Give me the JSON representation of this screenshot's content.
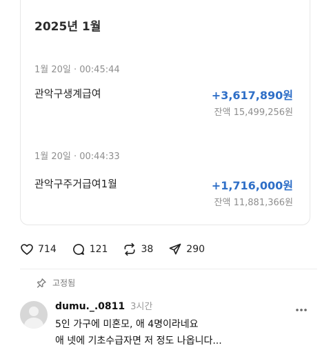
{
  "card": {
    "month_title": "2025년 1월",
    "transactions": [
      {
        "date": "1월 20일 · 00:45:44",
        "name": "관악구생계급여",
        "amount": "+3,617,890원",
        "balance": "잔액 15,499,256원"
      },
      {
        "date": "1월 20일 · 00:44:33",
        "name": "관악구주거급여1월",
        "amount": "+1,716,000원",
        "balance": "잔액 11,881,366원"
      }
    ]
  },
  "actions": {
    "like_count": "714",
    "reply_count": "121",
    "repost_count": "38",
    "share_count": "290"
  },
  "pinned": {
    "label": "고정됨"
  },
  "comment": {
    "username": "dumu._.0811",
    "time": "3시간",
    "lines": [
      "5인 가구에 미혼모, 애 4명이라네요",
      "애 넷에 기초수급자면 저 정도 나옵니다..."
    ]
  },
  "colors": {
    "amount": "#2f6fc7",
    "muted": "#8e8e8e"
  }
}
